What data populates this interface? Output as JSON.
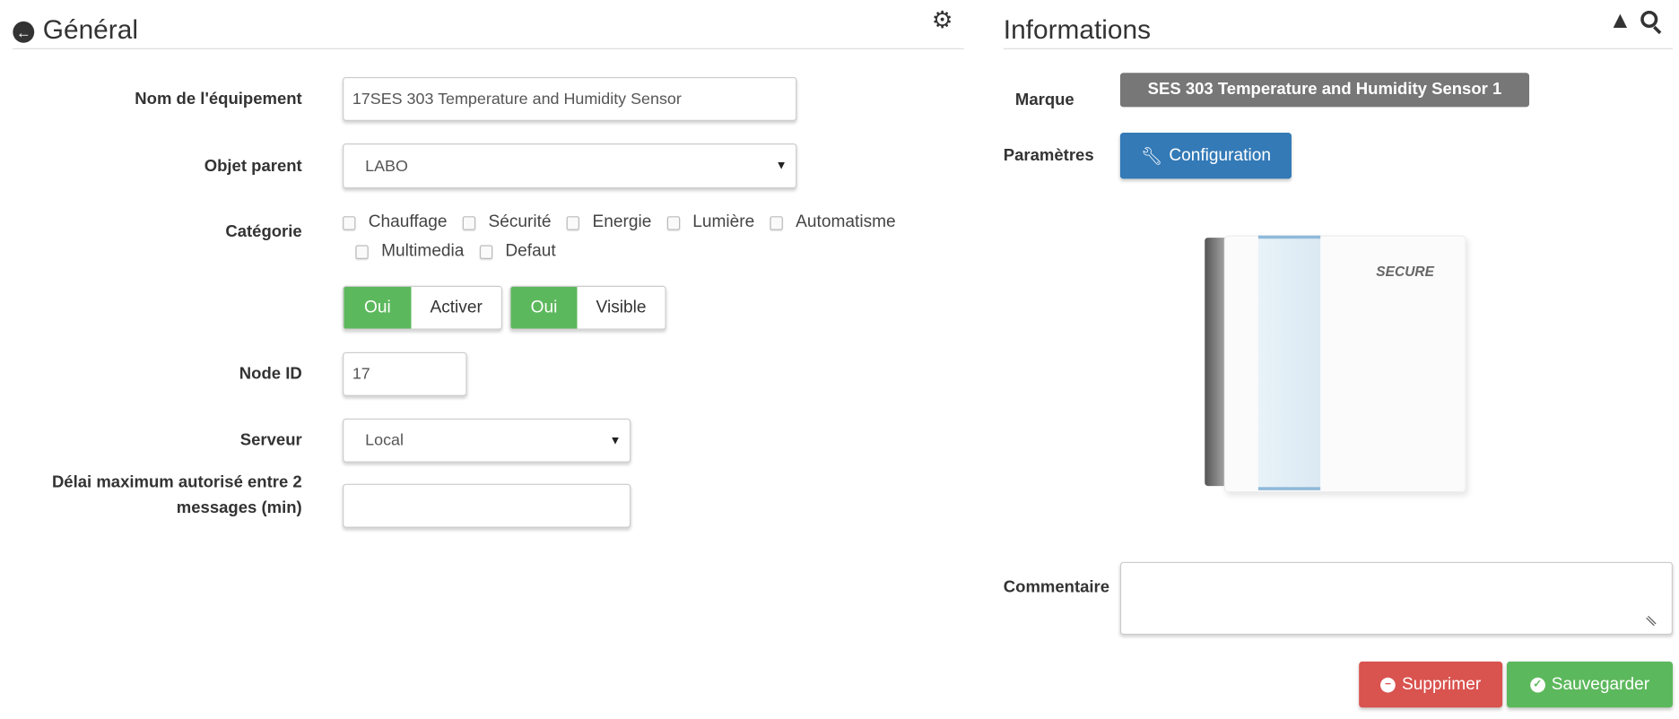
{
  "general": {
    "title": "Général",
    "fields": {
      "name_label": "Nom de l'équipement",
      "name_value": "17SES 303 Temperature and Humidity Sensor",
      "parent_label": "Objet parent",
      "parent_value": "LABO",
      "category_label": "Catégorie",
      "categories": [
        "Chauffage",
        "Sécurité",
        "Energie",
        "Lumière",
        "Automatisme",
        "Multimedia",
        "Defaut"
      ],
      "activate_on": "Oui",
      "activate_label": "Activer",
      "visible_on": "Oui",
      "visible_label": "Visible",
      "node_label": "Node ID",
      "node_value": "17",
      "server_label": "Serveur",
      "server_value": "Local",
      "delay_label_1": "Délai maximum autorisé entre 2",
      "delay_label_2": "messages (min)",
      "delay_value": ""
    }
  },
  "info": {
    "title": "Informations",
    "brand_label": "Marque",
    "brand_value": "SES 303 Temperature and Humidity Sensor 1",
    "params_label": "Paramètres",
    "config_button": "Configuration",
    "device_logo": "SECURE",
    "comment_label": "Commentaire",
    "comment_value": "",
    "delete_button": "Supprimer",
    "save_button": "Sauvegarder"
  },
  "colors": {
    "primary": "#337ab7",
    "success": "#5cb85c",
    "danger": "#d9534f",
    "badge": "#777777"
  }
}
